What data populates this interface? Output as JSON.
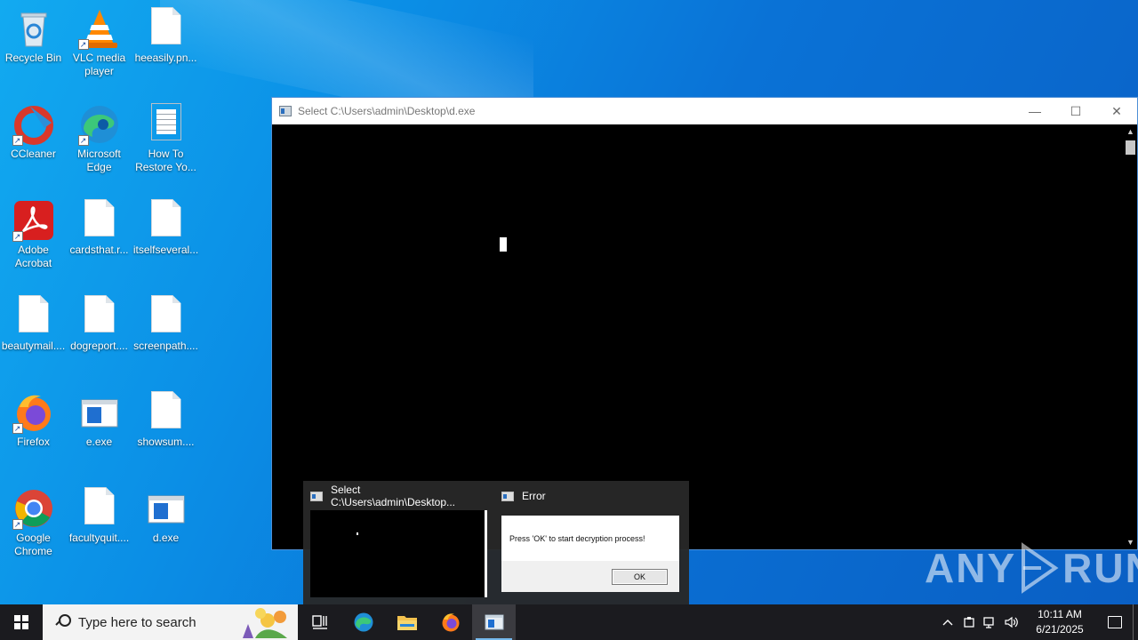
{
  "desktop": {
    "icons": [
      {
        "label": "Recycle Bin",
        "icon": "recycle-bin-icon"
      },
      {
        "label": "VLC media player",
        "icon": "vlc-icon"
      },
      {
        "label": "heeasily.pn...",
        "icon": "file-icon"
      },
      {
        "label": "CCleaner",
        "icon": "ccleaner-icon"
      },
      {
        "label": "Microsoft Edge",
        "icon": "edge-icon"
      },
      {
        "label": "How To Restore Yo...",
        "icon": "text-file-icon"
      },
      {
        "label": "Adobe Acrobat",
        "icon": "acrobat-icon"
      },
      {
        "label": "cardsthat.r...",
        "icon": "file-icon"
      },
      {
        "label": "itselfseveral...",
        "icon": "file-icon"
      },
      {
        "label": "beautymail....",
        "icon": "file-icon"
      },
      {
        "label": "dogreport....",
        "icon": "file-icon"
      },
      {
        "label": "screenpath....",
        "icon": "file-icon"
      },
      {
        "label": "Firefox",
        "icon": "firefox-icon"
      },
      {
        "label": "e.exe",
        "icon": "exe-icon"
      },
      {
        "label": "showsum....",
        "icon": "file-icon"
      },
      {
        "label": "Google Chrome",
        "icon": "chrome-icon"
      },
      {
        "label": "facultyquit....",
        "icon": "file-icon"
      },
      {
        "label": "d.exe",
        "icon": "exe-icon"
      }
    ]
  },
  "console_window": {
    "title": "Select C:\\Users\\admin\\Desktop\\d.exe",
    "minimize": "—",
    "maximize": "☐",
    "close": "✕"
  },
  "thumbnails": {
    "console_title": "Select C:\\Users\\admin\\Desktop...",
    "error_title": "Error",
    "error_message": "Press 'OK' to start decryption process!",
    "ok_label": "OK"
  },
  "watermark": {
    "left": "ANY",
    "right": "RUN"
  },
  "taskbar": {
    "search_placeholder": "Type here to search",
    "apps": [
      "task-view-icon",
      "edge-icon",
      "file-explorer-icon",
      "firefox-icon",
      "console-icon"
    ],
    "clock_time": "10:11 AM",
    "clock_date": "6/21/2025"
  },
  "colors": {
    "accent": "#76b9ed",
    "taskbar": "#1b1b1f",
    "desktop": "#0b8fe6"
  }
}
